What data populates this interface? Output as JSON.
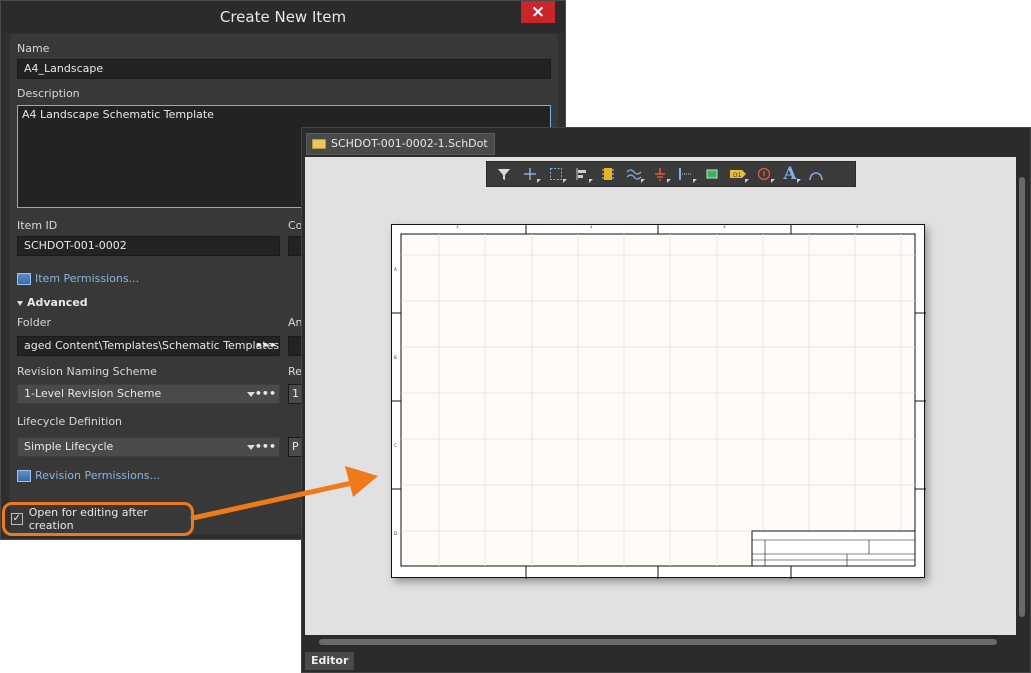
{
  "dialog": {
    "title": "Create New Item",
    "close_icon": "close-icon",
    "name_label": "Name",
    "name_value": "A4_Landscape",
    "description_label": "Description",
    "description_value": "A4 Landscape Schematic Template",
    "item_id_label": "Item ID",
    "item_id_value": "SCHDOT-001-0002",
    "content_label_partial": "Co",
    "item_permissions_link": "Item Permissions...",
    "advanced_label": "Advanced",
    "folder_label": "Folder",
    "folder_value": "aged Content\\Templates\\Schematic Templates",
    "folder_right_label_partial": "An",
    "revision_naming_label": "Revision Naming Scheme",
    "revision_naming_value": "1-Level Revision Scheme",
    "revision_right_label_partial": "Re",
    "revision_right_value_partial": "1",
    "lifecycle_label": "Lifecycle Definition",
    "lifecycle_value": "Simple Lifecycle",
    "lifecycle_right_value_partial": "P",
    "revision_permissions_link": "Revision Permissions...",
    "open_for_editing_label": "Open for editing after creation",
    "open_for_editing_checked": true,
    "ellipsis": "•••"
  },
  "editor": {
    "document_tab": "SCHDOT-001-0002-1.SchDot",
    "bottom_tab": "Editor",
    "toolbar_icons": [
      "filter-icon",
      "cross-icon",
      "select-rect-icon",
      "align-icon",
      "component-icon",
      "bus-icon",
      "ground-icon",
      "port-icon",
      "device-sheet-icon",
      "net-label-icon",
      "parameter-icon",
      "text-icon",
      "arc-icon"
    ],
    "text_tool_glyph": "A",
    "sheet_zone_columns": [
      "1",
      "2",
      "3",
      "4"
    ],
    "sheet_zone_rows": [
      "A",
      "B",
      "C",
      "D"
    ]
  },
  "colors": {
    "accent_orange": "#ee7a1c",
    "close_red": "#c8262b",
    "link_blue": "#8ab4e0"
  }
}
